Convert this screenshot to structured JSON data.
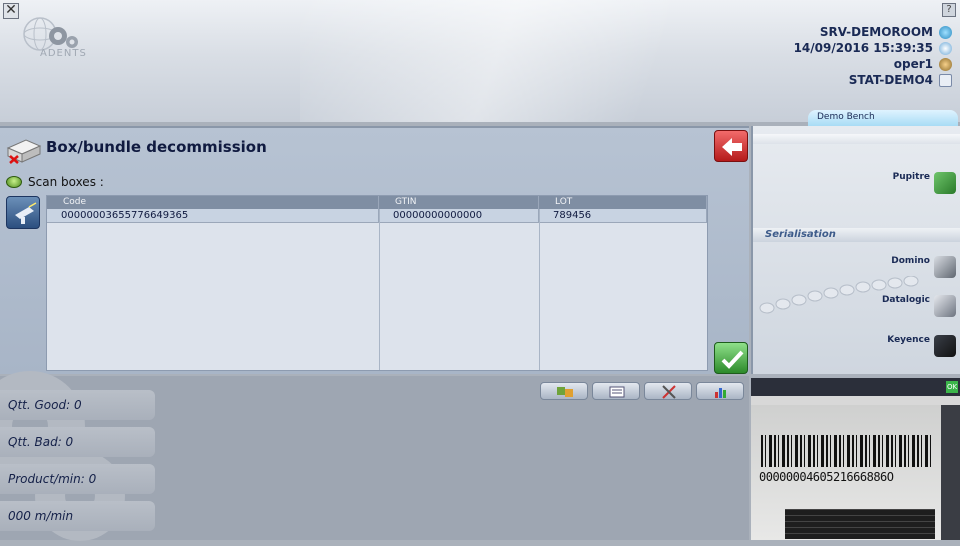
{
  "header": {
    "close_icon": "close-icon",
    "help_label": "?",
    "logo_text": "ADENTS",
    "server": "SRV-DEMOROOM",
    "datetime": "14/09/2016 15:39:35",
    "user": "oper1",
    "station": "STAT-DEMO4",
    "bench_tab": "Demo Bench"
  },
  "main": {
    "title": "Box/bundle decommission",
    "scan_label": "Scan boxes :",
    "table": {
      "columns": [
        "Code",
        "GTIN",
        "LOT"
      ],
      "rows": [
        [
          "00000003655776649365",
          "00000000000000",
          "789456"
        ]
      ]
    }
  },
  "right_panel": {
    "pupitre_label": "Pupitre",
    "serialisation_label": "Serialisation",
    "devices": [
      "Domino",
      "Datalogic",
      "Keyence"
    ]
  },
  "stats": {
    "good": "Qtt. Good: 0",
    "bad": "Qtt. Bad: 0",
    "rate": "Product/min: 0",
    "speed": "000 m/min"
  },
  "camera": {
    "ok_label": "OK",
    "barcode_text": "0000000460521666886O"
  },
  "colors": {
    "accent": "#1a2a55",
    "back_button": "#d23232",
    "ok_button": "#3aa83a"
  }
}
